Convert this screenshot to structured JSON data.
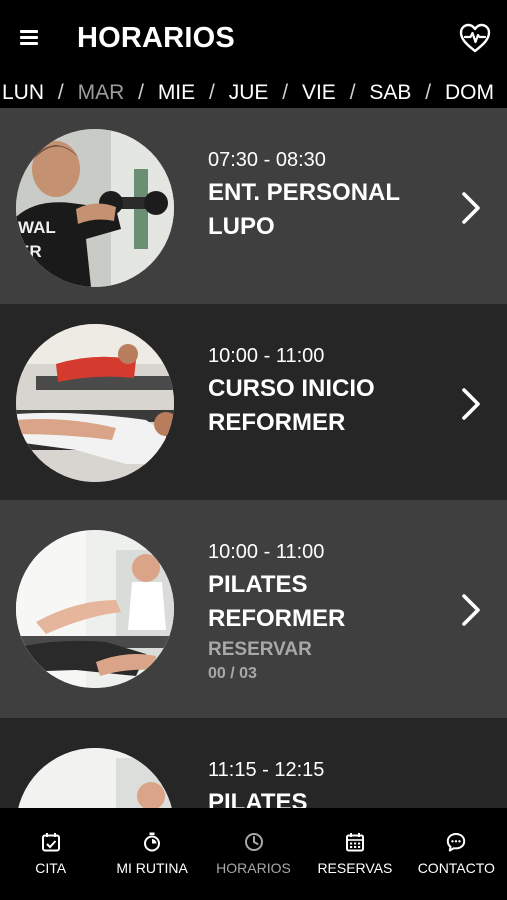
{
  "header": {
    "title": "HORARIOS",
    "menu_icon": "menu-icon",
    "action_icon": "heart-pulse-icon"
  },
  "days": [
    {
      "label": "LUN",
      "active": true
    },
    {
      "label": "MAR",
      "active": false
    },
    {
      "label": "MIE",
      "active": true
    },
    {
      "label": "JUE",
      "active": true
    },
    {
      "label": "VIE",
      "active": true
    },
    {
      "label": "SAB",
      "active": true
    },
    {
      "label": "DOM",
      "active": true
    }
  ],
  "day_separator": "/",
  "classes": [
    {
      "time": "07:30 - 08:30",
      "name": "ENT. PERSONAL LUPO",
      "name_lines": [
        "ENT. PERSONAL",
        "LUPO"
      ]
    },
    {
      "time": "10:00 - 11:00",
      "name": "CURSO INICIO REFORMER",
      "name_lines": [
        "CURSO INICIO",
        "REFORMER"
      ]
    },
    {
      "time": "10:00 - 11:00",
      "name": "PILATES REFORMER",
      "name_lines": [
        "PILATES",
        "REFORMER"
      ],
      "action": "RESERVAR",
      "spots": "00 / 03"
    },
    {
      "time": "11:15 - 12:15",
      "name": "PILATES",
      "name_lines": [
        "PILATES"
      ]
    }
  ],
  "tabs": [
    {
      "label": "CITA",
      "icon": "calendar-check-icon",
      "active": false
    },
    {
      "label": "MI RUTINA",
      "icon": "stopwatch-icon",
      "active": false
    },
    {
      "label": "HORARIOS",
      "icon": "clock-icon",
      "active": true
    },
    {
      "label": "RESERVAS",
      "icon": "calendar-grid-icon",
      "active": false
    },
    {
      "label": "CONTACTO",
      "icon": "chat-bubble-icon",
      "active": false
    }
  ],
  "colors": {
    "background": "#000000",
    "card_light": "#3f3f3f",
    "card_dark": "#262626",
    "muted": "#a8a8a8"
  }
}
